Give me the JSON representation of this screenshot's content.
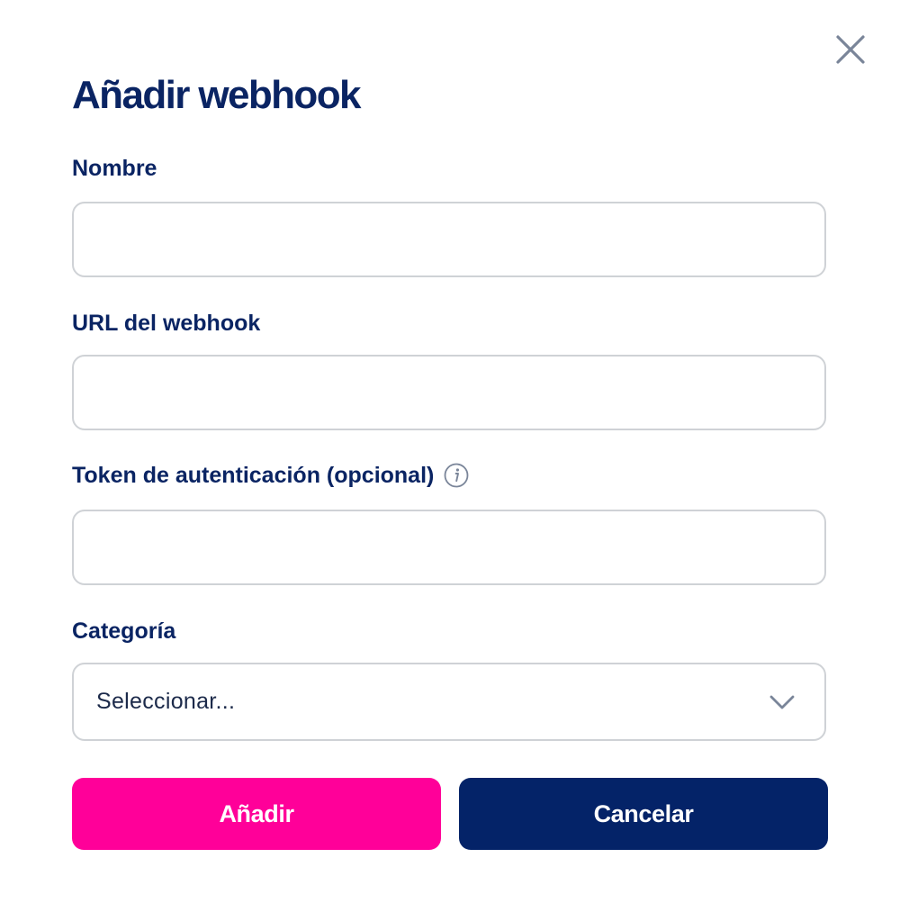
{
  "dialog": {
    "title": "Añadir webhook",
    "close_icon": "close-icon"
  },
  "fields": {
    "name": {
      "label": "Nombre",
      "value": "",
      "placeholder": ""
    },
    "url": {
      "label": "URL del webhook",
      "value": "",
      "placeholder": ""
    },
    "token": {
      "label": "Token de autenticación (opcional)",
      "value": "",
      "placeholder": "",
      "help_icon": "info-icon"
    },
    "category": {
      "label": "Categoría",
      "selected": "Seleccionar...",
      "dropdown_icon": "chevron-down-icon"
    }
  },
  "actions": {
    "add_label": "Añadir",
    "cancel_label": "Cancelar"
  },
  "colors": {
    "primary_text": "#0a2463",
    "add_button": "#ff0099",
    "cancel_button": "#042368",
    "border": "#cfd2d6",
    "icon_gray": "#7a8599"
  }
}
